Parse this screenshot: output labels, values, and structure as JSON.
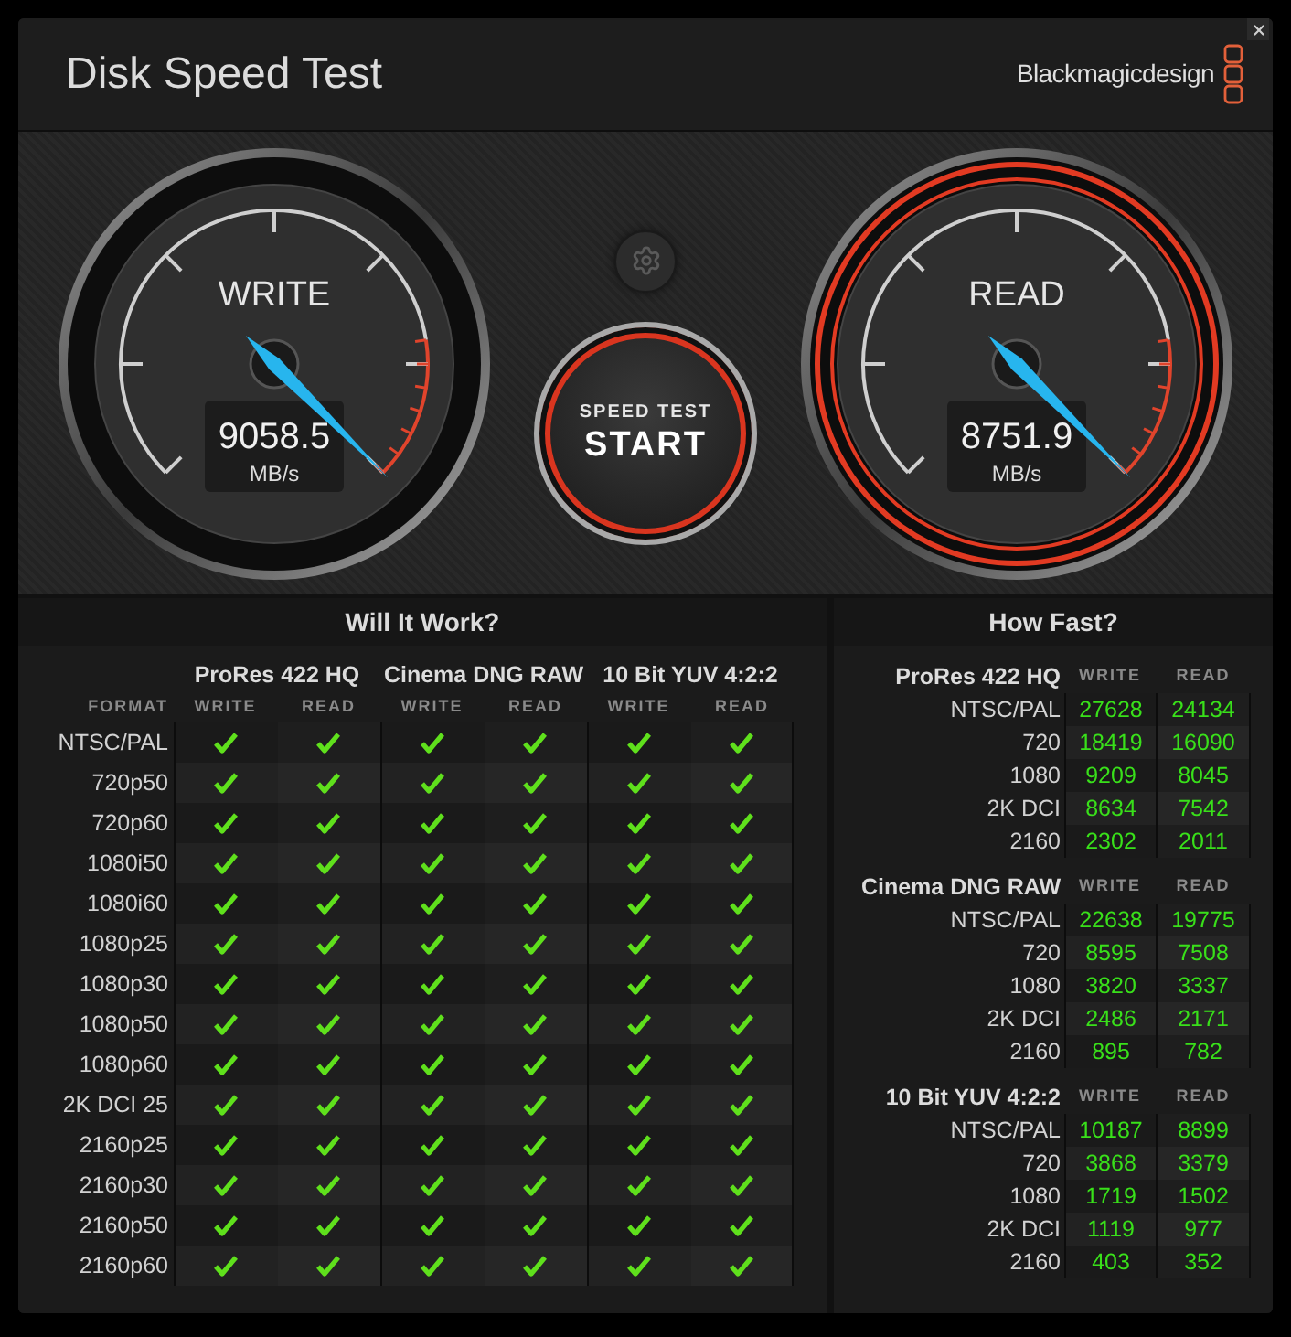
{
  "window": {
    "title": "Disk Speed Test",
    "brand": "Blackmagicdesign"
  },
  "gauges": [
    {
      "label": "WRITE",
      "value": "9058.5",
      "unit": "MB/s",
      "active": false
    },
    {
      "label": "READ",
      "value": "8751.9",
      "unit": "MB/s",
      "active": true
    }
  ],
  "start_button": {
    "line_1": "SPEED TEST",
    "line_2": "START",
    "active": true
  },
  "will_it_work": {
    "title": "Will It Work?",
    "format_heading": "FORMAT",
    "codecs": [
      {
        "name": "ProRes 422 HQ",
        "columns": [
          "WRITE",
          "READ"
        ]
      },
      {
        "name": "Cinema DNG RAW",
        "columns": [
          "WRITE",
          "READ"
        ]
      },
      {
        "name": "10 Bit YUV 4:2:2",
        "columns": [
          "WRITE",
          "READ"
        ]
      }
    ],
    "rows": [
      {
        "format": "NTSC/PAL",
        "checks": [
          true,
          true,
          true,
          true,
          true,
          true
        ]
      },
      {
        "format": "720p50",
        "checks": [
          true,
          true,
          true,
          true,
          true,
          true
        ]
      },
      {
        "format": "720p60",
        "checks": [
          true,
          true,
          true,
          true,
          true,
          true
        ]
      },
      {
        "format": "1080i50",
        "checks": [
          true,
          true,
          true,
          true,
          true,
          true
        ]
      },
      {
        "format": "1080i60",
        "checks": [
          true,
          true,
          true,
          true,
          true,
          true
        ]
      },
      {
        "format": "1080p25",
        "checks": [
          true,
          true,
          true,
          true,
          true,
          true
        ]
      },
      {
        "format": "1080p30",
        "checks": [
          true,
          true,
          true,
          true,
          true,
          true
        ]
      },
      {
        "format": "1080p50",
        "checks": [
          true,
          true,
          true,
          true,
          true,
          true
        ]
      },
      {
        "format": "1080p60",
        "checks": [
          true,
          true,
          true,
          true,
          true,
          true
        ]
      },
      {
        "format": "2K DCI 25",
        "checks": [
          true,
          true,
          true,
          true,
          true,
          true
        ]
      },
      {
        "format": "2160p25",
        "checks": [
          true,
          true,
          true,
          true,
          true,
          true
        ]
      },
      {
        "format": "2160p30",
        "checks": [
          true,
          true,
          true,
          true,
          true,
          true
        ]
      },
      {
        "format": "2160p50",
        "checks": [
          true,
          true,
          true,
          true,
          true,
          true
        ]
      },
      {
        "format": "2160p60",
        "checks": [
          true,
          true,
          true,
          true,
          true,
          true
        ]
      }
    ]
  },
  "how_fast": {
    "title": "How Fast?",
    "groups": [
      {
        "name": "ProRes 422 HQ",
        "columns": [
          "WRITE",
          "READ"
        ],
        "rows": [
          {
            "format": "NTSC/PAL",
            "write": "27628",
            "read": "24134"
          },
          {
            "format": "720",
            "write": "18419",
            "read": "16090"
          },
          {
            "format": "1080",
            "write": "9209",
            "read": "8045"
          },
          {
            "format": "2K DCI",
            "write": "8634",
            "read": "7542"
          },
          {
            "format": "2160",
            "write": "2302",
            "read": "2011"
          }
        ]
      },
      {
        "name": "Cinema DNG RAW",
        "columns": [
          "WRITE",
          "READ"
        ],
        "rows": [
          {
            "format": "NTSC/PAL",
            "write": "22638",
            "read": "19775"
          },
          {
            "format": "720",
            "write": "8595",
            "read": "7508"
          },
          {
            "format": "1080",
            "write": "3820",
            "read": "3337"
          },
          {
            "format": "2K DCI",
            "write": "2486",
            "read": "2171"
          },
          {
            "format": "2160",
            "write": "895",
            "read": "782"
          }
        ]
      },
      {
        "name": "10 Bit YUV 4:2:2",
        "columns": [
          "WRITE",
          "READ"
        ],
        "rows": [
          {
            "format": "NTSC/PAL",
            "write": "10187",
            "read": "8899"
          },
          {
            "format": "720",
            "write": "3868",
            "read": "3379"
          },
          {
            "format": "1080",
            "write": "1719",
            "read": "1502"
          },
          {
            "format": "2K DCI",
            "write": "1119",
            "read": "977"
          },
          {
            "format": "2160",
            "write": "403",
            "read": "352"
          }
        ]
      }
    ]
  }
}
